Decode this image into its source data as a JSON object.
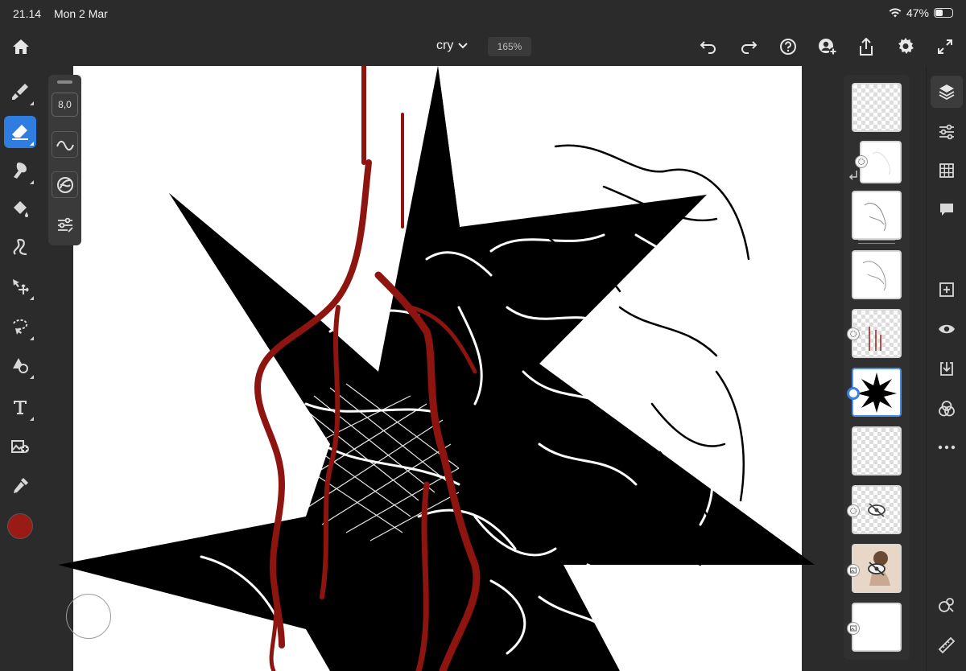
{
  "status": {
    "time": "21.14",
    "date": "Mon 2 Mar",
    "battery": "47%",
    "battery_level": 0.47
  },
  "document": {
    "name": "cry",
    "zoom": "165%"
  },
  "brush": {
    "size": "8,0"
  },
  "colors": {
    "accent": "#2f7de1",
    "current_color": "#9a1b16",
    "blood": "#8e1410",
    "ui_bg": "#2b2b2b"
  },
  "left_tools": [
    "brush-icon",
    "eraser-icon",
    "smudge-icon",
    "fill-icon",
    "liquify-icon",
    "move-icon",
    "lasso-icon",
    "transform-icon",
    "text-icon",
    "place-image-icon",
    "eyedropper-icon"
  ],
  "topbar_icons": [
    "home-icon",
    "undo-icon",
    "redo-icon",
    "help-icon",
    "invite-icon",
    "share-icon",
    "settings-icon",
    "fullscreen-icon"
  ],
  "right_rail": [
    "layers-icon",
    "adjustments-icon",
    "grid-icon",
    "comment-icon",
    "add-layer-icon",
    "visibility-icon",
    "import-icon",
    "blend-icon",
    "more-icon",
    "shapes-icon",
    "ruler-icon"
  ],
  "layers": [
    {
      "name": "layer-1",
      "content": "empty",
      "badge": "none"
    },
    {
      "name": "layer-2",
      "content": "sketch-faint",
      "badge": "mask"
    },
    {
      "name": "layer-3",
      "content": "lineart",
      "badge": "none"
    },
    {
      "name": "layer-4",
      "content": "lineart",
      "badge": "none"
    },
    {
      "name": "layer-5",
      "content": "blood",
      "badge": "mask"
    },
    {
      "name": "layer-6",
      "content": "star",
      "badge": "selected"
    },
    {
      "name": "layer-7",
      "content": "empty",
      "badge": "none"
    },
    {
      "name": "layer-8",
      "content": "hidden",
      "badge": "mask"
    },
    {
      "name": "layer-9",
      "content": "reference-photo-hidden",
      "badge": "image"
    },
    {
      "name": "layer-10",
      "content": "white",
      "badge": "image"
    }
  ]
}
